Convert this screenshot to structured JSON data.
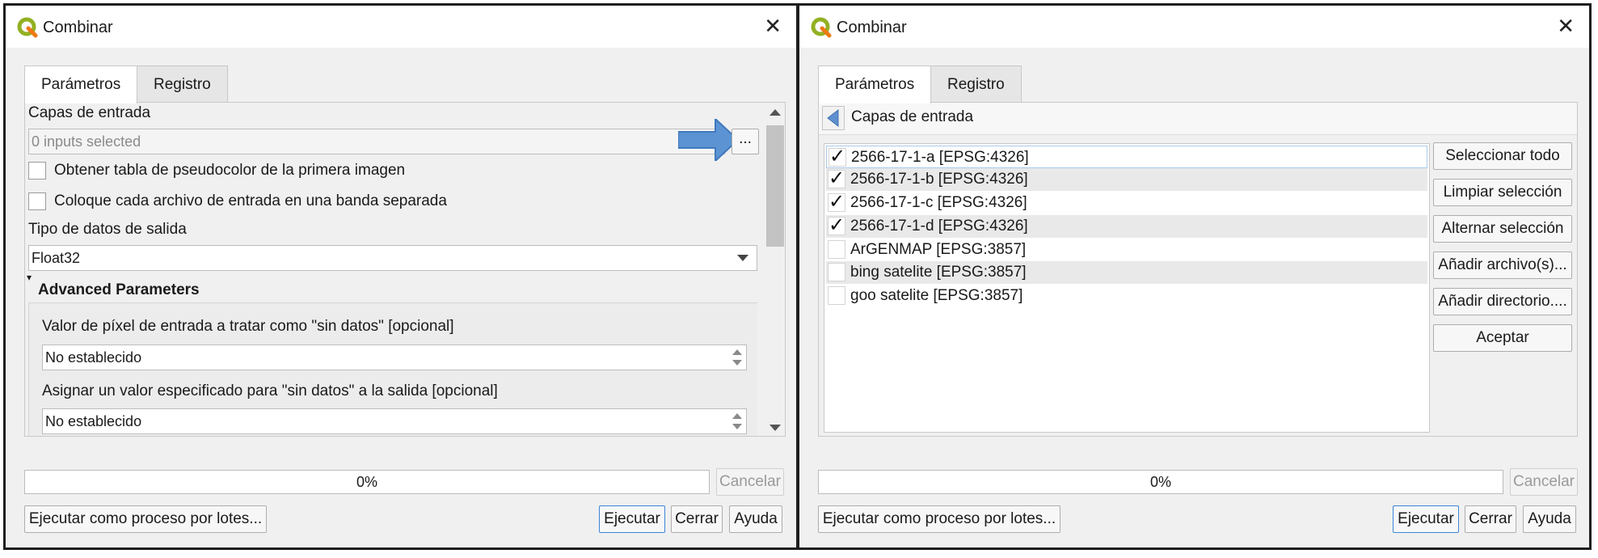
{
  "left": {
    "title": "Combinar",
    "tabs": [
      "Parámetros",
      "Registro"
    ],
    "input_layers_label": "Capas de entrada",
    "inputs_value": "0 inputs selected",
    "browse_button": "...",
    "checkbox_pseudocolor": "Obtener tabla de pseudocolor de la primera imagen",
    "checkbox_separate_band": "Coloque cada archivo de entrada en una banda separada",
    "data_type_label": "Tipo de datos de salida",
    "data_type_value": "Float32",
    "advanced_header": "Advanced Parameters",
    "nodata_input_label": "Valor de píxel de entrada a tratar como \"sin datos\" [opcional]",
    "nodata_input_value": "No establecido",
    "nodata_output_label": "Asignar un valor especificado para \"sin datos\" a la salida [opcional]",
    "nodata_output_value": "No establecido",
    "progress_text": "0%",
    "progress_value": 0,
    "cancel": "Cancelar",
    "batch": "Ejecutar como proceso por lotes...",
    "run": "Ejecutar",
    "close": "Cerrar",
    "help": "Ayuda",
    "accent_color": "#4f8fd6"
  },
  "right": {
    "title": "Combinar",
    "tabs": [
      "Parámetros",
      "Registro"
    ],
    "back_header": "Capas de entrada",
    "layers": [
      {
        "name": "2566-17-1-a [EPSG:4326]",
        "checked": true,
        "mark": "✓"
      },
      {
        "name": "2566-17-1-b [EPSG:4326]",
        "checked": true,
        "mark": "✓"
      },
      {
        "name": "2566-17-1-c [EPSG:4326]",
        "checked": true,
        "mark": "✓"
      },
      {
        "name": "2566-17-1-d [EPSG:4326]",
        "checked": true,
        "mark": "✓"
      },
      {
        "name": "ArGENMAP [EPSG:3857]",
        "checked": false,
        "mark": ""
      },
      {
        "name": "bing satelite [EPSG:3857]",
        "checked": false,
        "mark": ""
      },
      {
        "name": "goo satelite [EPSG:3857]",
        "checked": false,
        "mark": ""
      }
    ],
    "buttons": [
      "Seleccionar todo",
      "Limpiar selección",
      "Alternar selección",
      "Añadir archivo(s)...",
      "Añadir directorio....",
      "Aceptar"
    ],
    "progress_text": "0%",
    "progress_value": 0,
    "cancel": "Cancelar",
    "batch": "Ejecutar como proceso por lotes...",
    "run": "Ejecutar",
    "close": "Cerrar",
    "help": "Ayuda"
  }
}
